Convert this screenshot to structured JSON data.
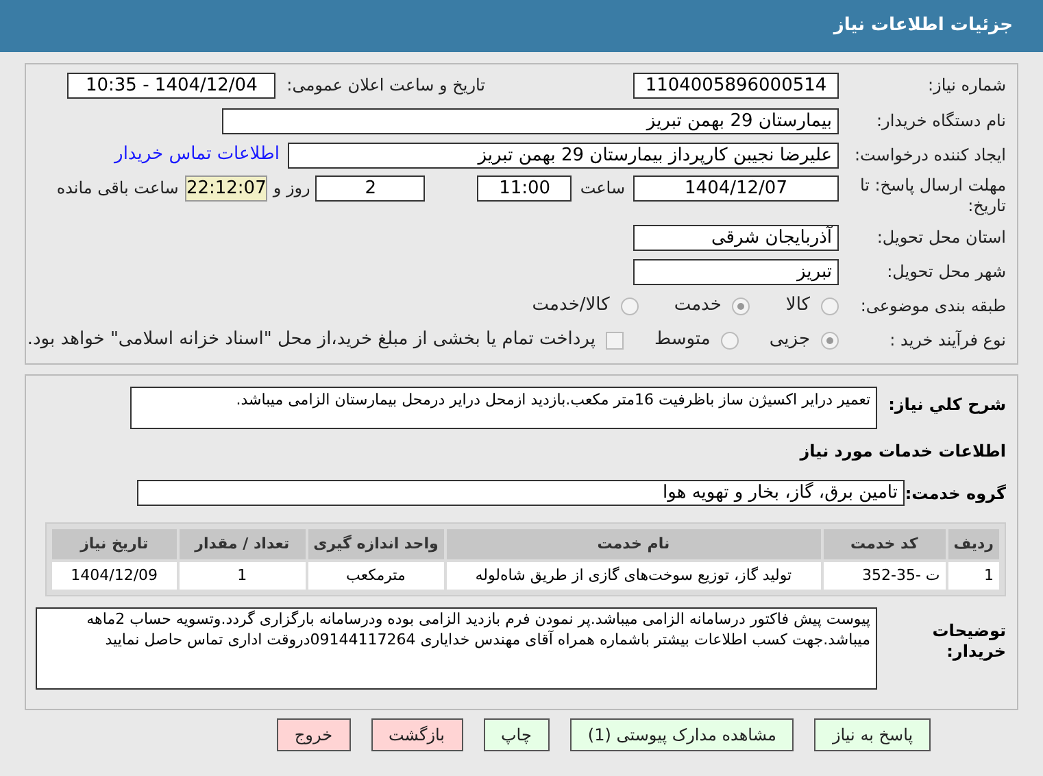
{
  "header": {
    "title": "جزئیات اطلاعات نیاز"
  },
  "need_number": {
    "label": "شماره نیاز:",
    "value": "1104005896000514"
  },
  "announce": {
    "label": "تاریخ و ساعت اعلان عمومی:",
    "value": "1404/12/04 - 10:35"
  },
  "buyer": {
    "label": "نام دستگاه خریدار:",
    "value": "بیمارستان 29 بهمن تبریز"
  },
  "creator": {
    "label": "ایجاد کننده درخواست:",
    "value": "علیرضا نجیبن کارپرداز بیمارستان 29 بهمن تبریز",
    "link": "اطلاعات تماس خریدار"
  },
  "deadline": {
    "label": "مهلت ارسال پاسخ: تا تاریخ:",
    "date": "1404/12/07",
    "time_label": "ساعت",
    "time": "11:00",
    "days": "2",
    "days_label": "روز و",
    "remaining": "22:12:07",
    "remaining_label": "ساعت باقی مانده"
  },
  "province": {
    "label": "استان محل تحویل:",
    "value": "آذربایجان شرقی"
  },
  "city": {
    "label": "شهر محل تحویل:",
    "value": "تبریز"
  },
  "category": {
    "label": "طبقه بندی موضوعی:",
    "options": [
      {
        "label": "کالا",
        "selected": false
      },
      {
        "label": "خدمت",
        "selected": true
      },
      {
        "label": "کالا/خدمت",
        "selected": false
      }
    ]
  },
  "purchase_type": {
    "label": "نوع فرآیند خرید :",
    "options": [
      {
        "label": "جزیی",
        "selected": true
      },
      {
        "label": "متوسط",
        "selected": false
      }
    ],
    "payment": {
      "checked": false,
      "label": "پرداخت تمام یا بخشی از مبلغ خرید،از محل \"اسناد خزانه اسلامی\" خواهد بود."
    }
  },
  "summary": {
    "label": "شرح کلي نياز:",
    "value": "تعمیر درایر اکسیژن ساز باظرفیت 16متر مکعب.بازدید ازمحل درایر درمحل بیمارستان الزامی میباشد."
  },
  "services_title": "اطلاعات خدمات مورد نیاز",
  "service_group": {
    "label": "گروه خدمت:",
    "value": "تامین برق، گاز، بخار و تهویه هوا"
  },
  "table": {
    "columns": [
      "ردیف",
      "کد خدمت",
      "نام خدمت",
      "واحد اندازه گیری",
      "تعداد / مقدار",
      "تاریخ نیاز"
    ],
    "rows": [
      [
        "1",
        "ت -35-352",
        "تولید گاز، توزیع سوخت‌های گازی از طریق شاه‌لوله",
        "مترمکعب",
        "1",
        "1404/12/09"
      ]
    ]
  },
  "buyer_notes": {
    "label": "توضیحات خریدار:",
    "value": "پیوست پیش فاکتور درسامانه الزامی میباشد.پر نمودن فرم بازدید الزامی بوده ودرسامانه بارگزاری گردد.وتسویه حساب 2ماهه میباشد.جهت کسب اطلاعات بیشتر باشماره همراه آقای مهندس خدایاری 09144117264دروقت اداری تماس حاصل نمایید"
  },
  "buttons": [
    {
      "label": "پاسخ به نیاز",
      "kind": "primary"
    },
    {
      "label": "مشاهده مدارک پیوستی (1)",
      "kind": "primary"
    },
    {
      "label": "چاپ",
      "kind": "primary"
    },
    {
      "label": "بازگشت",
      "kind": "danger"
    },
    {
      "label": "خروج",
      "kind": "danger"
    }
  ]
}
